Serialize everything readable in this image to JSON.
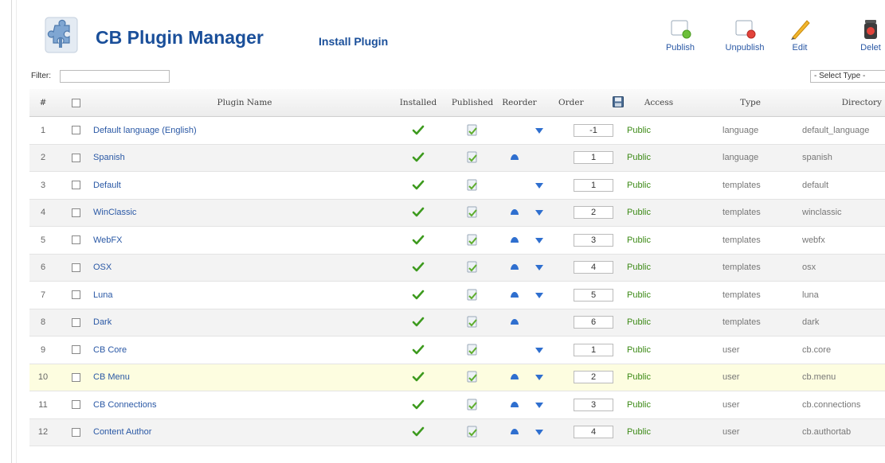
{
  "header": {
    "title": "CB Plugin Manager",
    "subtitle": "Install Plugin"
  },
  "toolbar": {
    "publish_label": "Publish",
    "unpublish_label": "Unpublish",
    "edit_label": "Edit",
    "delete_label": "Delet"
  },
  "filter": {
    "label": "Filter:",
    "value": ""
  },
  "type_select": {
    "selected": "- Select Type -"
  },
  "table": {
    "columns": {
      "num": "#",
      "name": "Plugin Name",
      "installed": "Installed",
      "published": "Published",
      "reorder": "Reorder",
      "order": "Order",
      "access": "Access",
      "type": "Type",
      "directory": "Directory"
    },
    "rows": [
      {
        "num": "1",
        "name": "Default language (English)",
        "order": "-1",
        "access": "Public",
        "type": "language",
        "directory": "default_language",
        "up": false,
        "down": true
      },
      {
        "num": "2",
        "name": "Spanish",
        "order": "1",
        "access": "Public",
        "type": "language",
        "directory": "spanish",
        "up": true,
        "down": false
      },
      {
        "num": "3",
        "name": "Default",
        "order": "1",
        "access": "Public",
        "type": "templates",
        "directory": "default",
        "up": false,
        "down": true
      },
      {
        "num": "4",
        "name": "WinClassic",
        "order": "2",
        "access": "Public",
        "type": "templates",
        "directory": "winclassic",
        "up": true,
        "down": true
      },
      {
        "num": "5",
        "name": "WebFX",
        "order": "3",
        "access": "Public",
        "type": "templates",
        "directory": "webfx",
        "up": true,
        "down": true
      },
      {
        "num": "6",
        "name": "OSX",
        "order": "4",
        "access": "Public",
        "type": "templates",
        "directory": "osx",
        "up": true,
        "down": true
      },
      {
        "num": "7",
        "name": "Luna",
        "order": "5",
        "access": "Public",
        "type": "templates",
        "directory": "luna",
        "up": true,
        "down": true
      },
      {
        "num": "8",
        "name": "Dark",
        "order": "6",
        "access": "Public",
        "type": "templates",
        "directory": "dark",
        "up": true,
        "down": false
      },
      {
        "num": "9",
        "name": "CB Core",
        "order": "1",
        "access": "Public",
        "type": "user",
        "directory": "cb.core",
        "up": false,
        "down": true
      },
      {
        "num": "10",
        "name": "CB Menu",
        "order": "2",
        "access": "Public",
        "type": "user",
        "directory": "cb.menu",
        "up": true,
        "down": true
      },
      {
        "num": "11",
        "name": "CB Connections",
        "order": "3",
        "access": "Public",
        "type": "user",
        "directory": "cb.connections",
        "up": true,
        "down": true
      },
      {
        "num": "12",
        "name": "Content Author",
        "order": "4",
        "access": "Public",
        "type": "user",
        "directory": "cb.authortab",
        "up": true,
        "down": true
      }
    ]
  },
  "colors": {
    "link": "#2a58a5",
    "title": "#1a4f9a",
    "access": "#3c8a16",
    "highlight_row": "#fdfde0"
  }
}
